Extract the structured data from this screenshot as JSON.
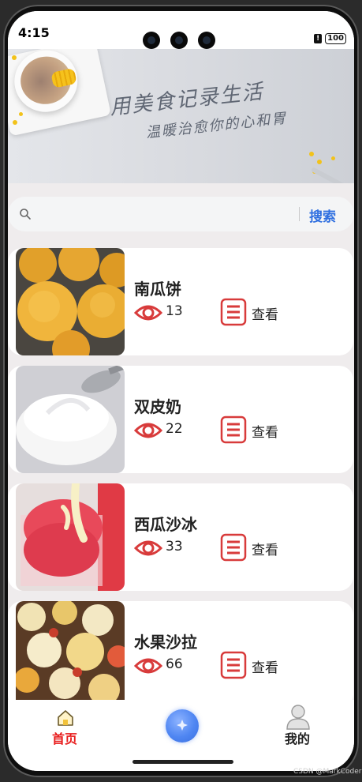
{
  "status_bar": {
    "time": "4:15",
    "battery": "100"
  },
  "banner": {
    "line1": "用美食记录生活",
    "line2": "温暖治愈你的心和胃",
    "active_slide": 3,
    "slide_count": 4
  },
  "search": {
    "placeholder": "",
    "button_label": "搜索"
  },
  "recipes": [
    {
      "title": "南瓜饼",
      "views": "13",
      "action_label": "查看"
    },
    {
      "title": "双皮奶",
      "views": "22",
      "action_label": "查看"
    },
    {
      "title": "西瓜沙冰",
      "views": "33",
      "action_label": "查看"
    },
    {
      "title": "水果沙拉",
      "views": "66",
      "action_label": "查看"
    }
  ],
  "tabs": {
    "home": "首页",
    "mine": "我的"
  },
  "watermark": "CSDN @MarkCoder",
  "colors": {
    "accent": "#2f6fe0",
    "active_tab": "#e81b1b",
    "icon_red": "#d83b3b"
  }
}
